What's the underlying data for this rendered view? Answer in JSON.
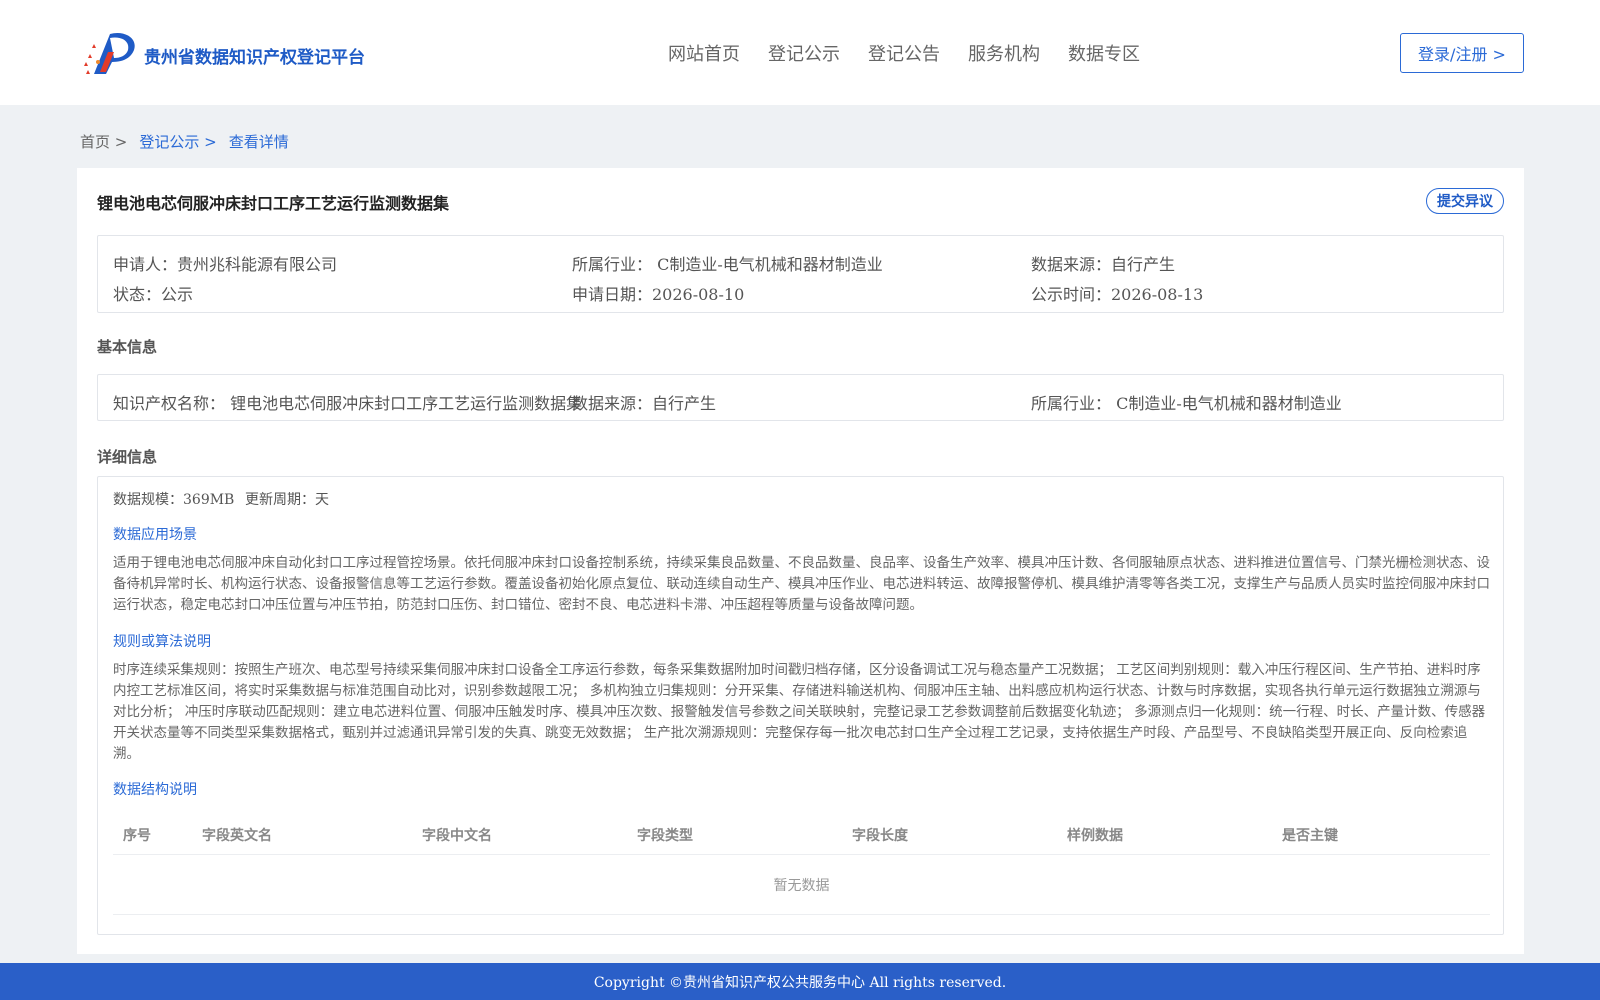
{
  "header": {
    "site_title": "贵州省数据知识产权登记平台",
    "nav": [
      "网站首页",
      "登记公示",
      "登记公告",
      "服务机构",
      "数据专区"
    ],
    "login_label": "登录/注册 >"
  },
  "breadcrumb": [
    "首页 >",
    "登记公示 >",
    "查看详情"
  ],
  "record": {
    "title": "锂电池电芯伺服冲床封口工序工艺运行监测数据集",
    "objection_label": "提交异议",
    "applicant": "申请人：贵州兆科能源有限公司",
    "industry": "所属行业： C制造业-电气机械和器材制造业",
    "source": "数据来源：自行产生",
    "status": "状态：公示",
    "apply_date": "申请日期：2026-08-10",
    "publish_time": "公示时间：2026-08-13"
  },
  "basic": {
    "section_title": "基本信息",
    "ip_name": "知识产权名称： 锂电池电芯伺服冲床封口工序工艺运行监测数据集",
    "source": "数据来源：自行产生",
    "industry": "所属行业： C制造业-电气机械和器材制造业"
  },
  "detail": {
    "section_title": "详细信息",
    "scale": "数据规模：369MB",
    "cycle": "更新周期：天",
    "scenario_title": "数据应用场景",
    "scenario_text": "适用于锂电池电芯伺服冲床自动化封口工序过程管控场景。依托伺服冲床封口设备控制系统，持续采集良品数量、不良品数量、良品率、设备生产效率、模具冲压计数、各伺服轴原点状态、进料推进位置信号、门禁光栅检测状态、设备待机异常时长、机构运行状态、设备报警信息等工艺运行参数。覆盖设备初始化原点复位、联动连续自动生产、模具冲压作业、电芯进料转运、故障报警停机、模具维护清零等各类工况，支撑生产与品质人员实时监控伺服冲床封口运行状态，稳定电芯封口冲压位置与冲压节拍，防范封口压伤、封口错位、密封不良、电芯进料卡滞、冲压超程等质量与设备故障问题。",
    "rules_title": "规则或算法说明",
    "rules_text": "时序连续采集规则：按照生产班次、电芯型号持续采集伺服冲床封口设备全工序运行参数，每条采集数据附加时间戳归档存储，区分设备调试工况与稳态量产工况数据； 工艺区间判别规则：载入冲压行程区间、生产节拍、进料时序内控工艺标准区间，将实时采集数据与标准范围自动比对，识别参数越限工况； 多机构独立归集规则：分开采集、存储进料输送机构、伺服冲压主轴、出料感应机构运行状态、计数与时序数据，实现各执行单元运行数据独立溯源与对比分析； 冲压时序联动匹配规则：建立电芯进料位置、伺服冲压触发时序、模具冲压次数、报警触发信号参数之间关联映射，完整记录工艺参数调整前后数据变化轨迹； 多源测点归一化规则：统一行程、时长、产量计数、传感器开关状态量等不同类型采集数据格式，甄别并过滤通讯异常引发的失真、跳变无效数据； 生产批次溯源规则：完整保存每一批次电芯封口生产全过程工艺记录，支持依据生产时段、产品型号、不良缺陷类型开展正向、反向检索追溯。",
    "structure_title": "数据结构说明",
    "table_headers": [
      "序号",
      "字段英文名",
      "字段中文名",
      "字段类型",
      "字段长度",
      "样例数据",
      "是否主键"
    ],
    "empty_text": "暂无数据"
  },
  "footer": {
    "copyright": "Copyright ©贵州省知识产权公共服务中心 All rights reserved."
  },
  "colors": {
    "brand_blue": "#1f5bc6",
    "link_blue": "#2b6ad6",
    "footer_blue": "#2a5fc8",
    "logo_red": "#e23b2a",
    "logo_orange": "#f08a2c"
  }
}
